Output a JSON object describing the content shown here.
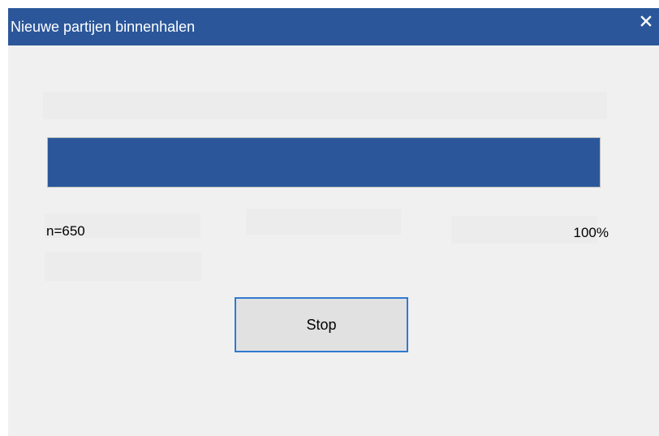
{
  "window": {
    "title": "Nieuwe partijen binnenhalen",
    "close_icon": "close-icon",
    "titlebar_color": "#2b579a",
    "background_color": "#f0f0f0"
  },
  "progress": {
    "value_fraction": 1.0,
    "fill_color": "#2b579a"
  },
  "status": {
    "count_label": "n=650",
    "percent_label": "100%"
  },
  "actions": {
    "stop_label": "Stop",
    "stop_border_color": "#2f7ad1"
  }
}
